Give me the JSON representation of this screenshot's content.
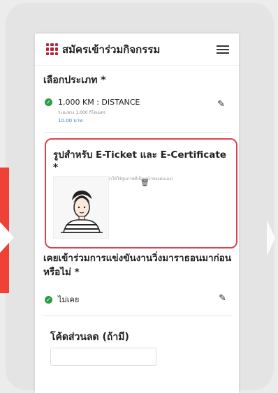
{
  "header": {
    "title": "สมัครเข้าร่วมกิจกรรม"
  },
  "type_section": {
    "label": "เลือกประเภท *",
    "option": {
      "title": "1,000 KM : DISTANCE",
      "subtitle": "ระยะทาง 1,000 กิโลเมตร",
      "price": "10.00 บาท"
    }
  },
  "photo_section": {
    "title": "รูปสำหรับ E-Ticket และ E-Certificate *",
    "hint": "ครอปรูป + เพื่อแสดงรูป (แนะนำให้ใช้รูปภาพที่เป็นหน้าของตนเอง)"
  },
  "experience_section": {
    "label": "เคยเข้าร่วมการแข่งขันงานวิ่งมาราธอนมาก่อนหรือไม่ *",
    "answer": "ไม่เคย"
  },
  "discount_section": {
    "label": "โค้ดส่วนลด (ถ้ามี)"
  },
  "colors": {
    "accent": "#e0404a",
    "check": "#2e9d47",
    "logo": "#b5263b"
  }
}
